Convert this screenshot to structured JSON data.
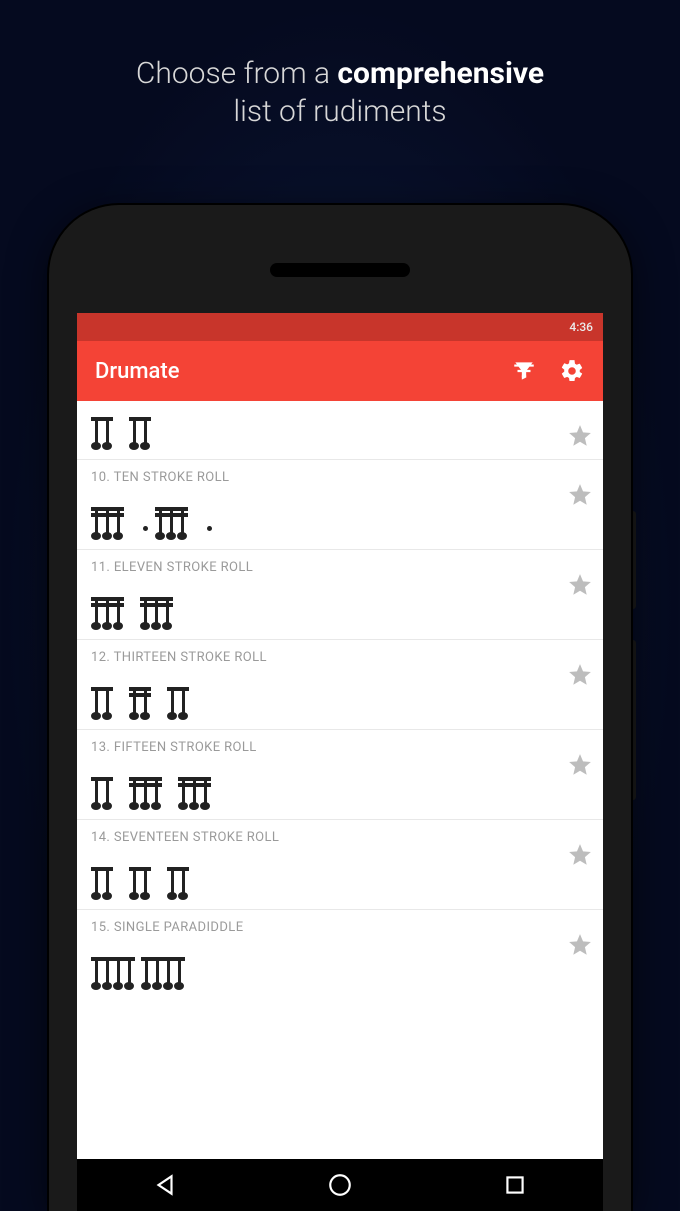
{
  "promo": {
    "line1_a": "Choose from a ",
    "line1_b": "comprehensive",
    "line2": "list of rudiments"
  },
  "statusbar": {
    "time": "4:36"
  },
  "appbar": {
    "title": "Drumate"
  },
  "items": [
    {
      "label": ""
    },
    {
      "label": "10. TEN STROKE ROLL"
    },
    {
      "label": "11. ELEVEN STROKE ROLL"
    },
    {
      "label": "12. THIRTEEN STROKE ROLL"
    },
    {
      "label": "13. FIFTEEN STROKE ROLL"
    },
    {
      "label": "14. SEVENTEEN STROKE ROLL"
    },
    {
      "label": "15. SINGLE PARADIDDLE"
    }
  ]
}
